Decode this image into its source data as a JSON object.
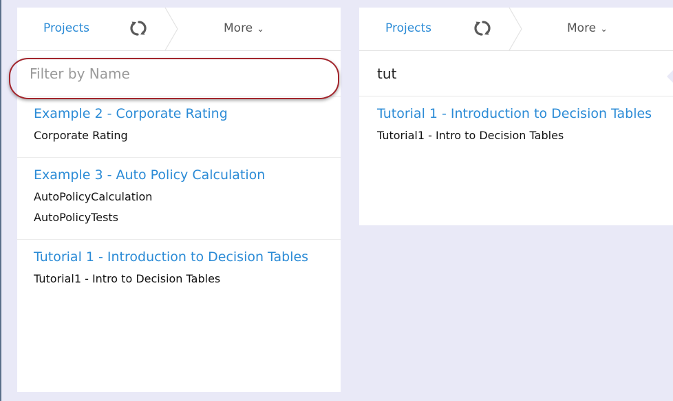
{
  "left_panel": {
    "nav": {
      "projects_label": "Projects",
      "more_label": "More"
    },
    "filter": {
      "placeholder": "Filter by Name",
      "value": ""
    },
    "projects": [
      {
        "title": "Example 2 - Corporate Rating",
        "items": [
          "Corporate Rating"
        ]
      },
      {
        "title": "Example 3 - Auto Policy Calculation",
        "items": [
          "AutoPolicyCalculation",
          "AutoPolicyTests"
        ]
      },
      {
        "title": "Tutorial 1 - Introduction to Decision Tables",
        "items": [
          "Tutorial1 - Intro to Decision Tables"
        ]
      }
    ]
  },
  "right_panel": {
    "nav": {
      "projects_label": "Projects",
      "more_label": "More"
    },
    "filter": {
      "placeholder": "Filter by Name",
      "value": "tut"
    },
    "projects": [
      {
        "title": "Tutorial 1 - Introduction to Decision Tables",
        "items": [
          "Tutorial1 - Intro to Decision Tables"
        ]
      }
    ]
  },
  "icons": {
    "refresh": "refresh-icon",
    "chevron": "chevron-down-icon"
  },
  "colors": {
    "link": "#2b8bd6",
    "background": "#e9e9f7",
    "highlight": "#a2252c"
  }
}
